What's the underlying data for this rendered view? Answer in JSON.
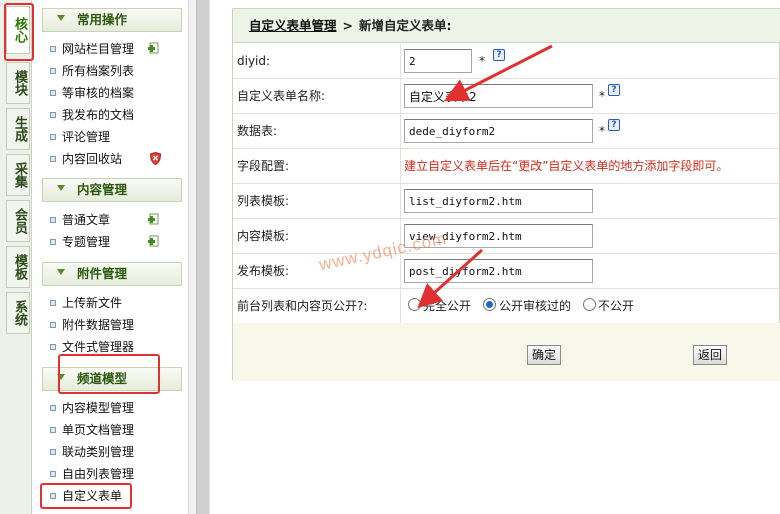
{
  "vtabs": [
    "核心",
    "模块",
    "生成",
    "采集",
    "会员",
    "模板",
    "系统"
  ],
  "menu": {
    "sections": [
      {
        "title": "常用操作",
        "items": [
          "网站栏目管理",
          "所有档案列表",
          "等审核的档案",
          "我发布的文档",
          "评论管理",
          "内容回收站"
        ]
      },
      {
        "title": "内容管理",
        "items": [
          "普通文章",
          "专题管理"
        ]
      },
      {
        "title": "附件管理",
        "items": [
          "上传新文件",
          "附件数据管理",
          "文件式管理器"
        ]
      },
      {
        "title": "频道模型",
        "items": [
          "内容模型管理",
          "单页文档管理",
          "联动类别管理",
          "自由列表管理",
          "自定义表单"
        ]
      }
    ]
  },
  "breadcrumb": {
    "parent": "自定义表单管理",
    "separator": ">",
    "current": "新增自定义表单:"
  },
  "form": {
    "diyid_label": "diyid:",
    "diyid_value": "2",
    "name_label": "自定义表单名称:",
    "name_value": "自定义表单2",
    "table_label": "数据表:",
    "table_value": "dede_diyform2",
    "fields_label": "字段配置:",
    "fields_note": "建立自定义表单后在“更改”自定义表单的地方添加字段即可。",
    "list_tpl_label": "列表模板:",
    "list_tpl_value": "list_diyform2.htm",
    "view_tpl_label": "内容模板:",
    "view_tpl_value": "view_diyform2.htm",
    "post_tpl_label": "发布模板:",
    "post_tpl_value": "post_diyform2.htm",
    "public_label": "前台列表和内容页公开?:",
    "public_options": [
      "完全公开",
      "公开审核过的",
      "不公开"
    ],
    "public_selected": "公开审核过的",
    "required_mark": "*",
    "help_glyph": "?"
  },
  "buttons": {
    "confirm": "确定",
    "back": "返回"
  },
  "watermark": "www.ydqic.com",
  "colors": {
    "highlight_box": "#e03030",
    "note_text": "#d12b1a",
    "arrow": "#e03030"
  }
}
